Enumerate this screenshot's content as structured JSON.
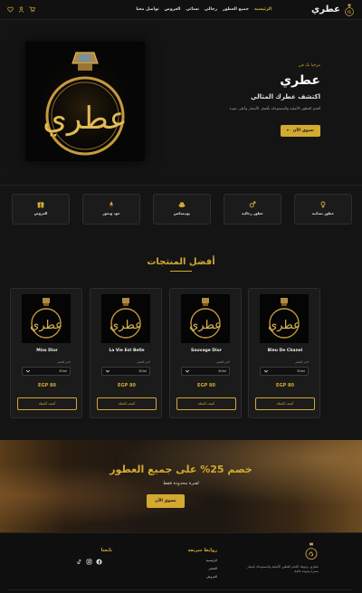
{
  "nav": {
    "brand": "عطري",
    "links": [
      "الرئيسية",
      "جميع العطور",
      "رجالي",
      "نسائي",
      "العروض",
      "تواصل معنا"
    ],
    "active_index": 0,
    "icons": [
      "cart-icon",
      "user-icon",
      "heart-icon"
    ]
  },
  "hero": {
    "welcome": "مرحبا بك في",
    "title": "عطري",
    "subtitle": "اكتشف عطرك المثالي",
    "description": "أفخم العطور الأصلية والمستوحاة بأفضل الأسعار وأعلى جودة",
    "cta_label": "تسوق الآن",
    "logo_word": "عطري"
  },
  "categories": [
    {
      "label": "عطور نسائية",
      "icon": "venus-icon"
    },
    {
      "label": "عطور رجالية",
      "icon": "mars-icon"
    },
    {
      "label": "يونيسكس",
      "icon": "perfume-bottle-icon"
    },
    {
      "label": "عود وبخور",
      "icon": "flame-icon"
    },
    {
      "label": "العروض",
      "icon": "gift-icon"
    }
  ],
  "products": {
    "section_title": "أفضل المنتجات",
    "size_label": "اختر الحجم",
    "size_value": "30ml",
    "add_label": "أضف للسلة",
    "items": [
      {
        "name": "Bleu De Chanel",
        "price": "EGP 80"
      },
      {
        "name": "Sauvage Dior",
        "price": "EGP 80"
      },
      {
        "name": "La Vie Est Belle",
        "price": "EGP 80"
      },
      {
        "name": "Miss Dior",
        "price": "EGP 80"
      }
    ]
  },
  "promo": {
    "title": "خصم 25% على جميع العطور",
    "subtitle": "لفترة محدودة فقط",
    "cta_label": "تسوق الآن"
  },
  "footer": {
    "about": "عطري، وجهتك لأفخم العطور الأصلية والمستوحاة بأسعار مميزة وجودة عالية.",
    "links_heading": "روابط سريعة",
    "links": [
      "الرئيسية",
      "المتجر",
      "العروض"
    ],
    "follow_heading": "تابعنا",
    "social": [
      "facebook-icon",
      "instagram-icon",
      "tiktok-icon"
    ]
  },
  "colors": {
    "accent": "#d4a930",
    "background": "#141414",
    "card": "#1b1b1b"
  }
}
